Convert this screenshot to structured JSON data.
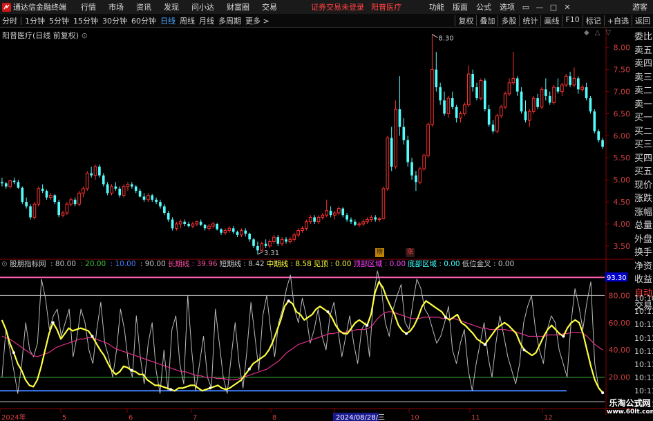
{
  "titlebar": {
    "app_name": "通达信金融终端",
    "menus": [
      "行情",
      "市场",
      "资讯",
      "发现",
      "问小达",
      "财富圈",
      "交易"
    ],
    "notice": "证券交易未登录",
    "stock": "阳普医疗",
    "right_menus": [
      "功能",
      "版面",
      "公式",
      "选项"
    ],
    "guest": "游客",
    "win_buttons": [
      "▭",
      "—",
      "□",
      "✕"
    ]
  },
  "toolbar": {
    "periods": [
      "分时",
      "1分钟",
      "5分钟",
      "15分钟",
      "30分钟",
      "60分钟",
      "日线",
      "周线",
      "月线",
      "多周期",
      "更多 >"
    ],
    "active_period": "日线",
    "right_buttons": [
      "复权",
      "叠加",
      "多股",
      "统计",
      "画线",
      "F10",
      "标记",
      "+自选",
      "返回"
    ]
  },
  "stock_header": "阳普医疗(日线 前复权)",
  "price_axis": [
    "8.00",
    "7.50",
    "7.00",
    "6.50",
    "6.00",
    "5.50",
    "5.00",
    "4.50",
    "4.00",
    "3.50"
  ],
  "markers": {
    "high": "8.30",
    "low": "3.31"
  },
  "badges": {
    "b1": "榜",
    "b2": "涨"
  },
  "indicator": {
    "name": "股朋指标网",
    "params": [
      {
        "label": "",
        "value": "80.00",
        "color": "#c8c8c8"
      },
      {
        "label": "",
        "value": "20.00",
        "color": "#40c040"
      },
      {
        "label": "",
        "value": "10.00",
        "color": "#4080ff"
      },
      {
        "label": "",
        "value": "90.00",
        "color": "#c8c8c8"
      },
      {
        "label": "长期线",
        "value": "39.96",
        "color": "#ff4fa0"
      },
      {
        "label": "短期线",
        "value": "8.42",
        "color": "#c8c8c8"
      },
      {
        "label": "中期线",
        "value": "8.58",
        "color": "#ffff40"
      },
      {
        "label": "见顶",
        "value": "0.00",
        "color": "#ffff40"
      },
      {
        "label": "顶部区域",
        "value": "0.00",
        "color": "#ff40ff"
      },
      {
        "label": "底部区域",
        "value": "0.00",
        "color": "#40ffff"
      },
      {
        "label": "低位金叉",
        "value": "0.00",
        "color": "#c8c8c8"
      }
    ],
    "axis": [
      "93.30",
      "80.00",
      "60.00",
      "40.00",
      "20.00"
    ]
  },
  "date_axis": [
    "2024年",
    "5",
    "6",
    "7",
    "8",
    "2024/08/28/三",
    "10",
    "11",
    "12"
  ],
  "side_panel": [
    "委比",
    "卖五",
    "卖四",
    "卖三",
    "卖二",
    "卖一",
    "买一",
    "买二",
    "买三",
    "买四",
    "买五",
    "现价",
    "涨跌",
    "涨幅",
    "总量",
    "外盘",
    "换手",
    "净资",
    "收益",
    "自动",
    "交易"
  ],
  "time_col": [
    "10:10",
    "10:11",
    "10:11",
    "10:11",
    "10:11",
    "10:11",
    "10:11",
    "10:11",
    "10:11"
  ],
  "watermark": {
    "line1": "乐淘公式网",
    "line2": "www.60lt.com"
  },
  "colors": {
    "up": "#ff3232",
    "down": "#54fcfc",
    "pink": "#ff5fb0",
    "yellow": "#ffff40",
    "green": "#40c040",
    "blue": "#4080ff",
    "grid": "#8b0000"
  },
  "chart_data": {
    "type": "candlestick",
    "price_range": [
      3.2,
      8.45
    ],
    "indicator_range": [
      0,
      100
    ],
    "candles": [
      [
        4.95,
        5.05,
        4.85,
        4.92
      ],
      [
        4.92,
        4.95,
        4.8,
        4.85
      ],
      [
        4.85,
        5.0,
        4.8,
        4.98
      ],
      [
        4.98,
        5.05,
        4.9,
        4.95
      ],
      [
        4.95,
        5.0,
        4.8,
        4.82
      ],
      [
        4.82,
        4.85,
        4.45,
        4.5
      ],
      [
        4.5,
        4.6,
        4.35,
        4.4
      ],
      [
        4.4,
        4.45,
        4.1,
        4.15
      ],
      [
        4.15,
        4.5,
        4.1,
        4.45
      ],
      [
        4.45,
        4.85,
        4.4,
        4.8
      ],
      [
        4.8,
        4.9,
        4.7,
        4.75
      ],
      [
        4.75,
        4.78,
        4.55,
        4.6
      ],
      [
        4.6,
        4.7,
        4.55,
        4.65
      ],
      [
        4.65,
        4.68,
        4.45,
        4.5
      ],
      [
        4.5,
        4.55,
        4.15,
        4.2
      ],
      [
        4.2,
        4.3,
        4.15,
        4.25
      ],
      [
        4.25,
        4.5,
        4.2,
        4.45
      ],
      [
        4.45,
        4.6,
        4.4,
        4.55
      ],
      [
        4.55,
        4.6,
        4.4,
        4.45
      ],
      [
        4.45,
        4.75,
        4.4,
        4.7
      ],
      [
        4.7,
        4.85,
        4.6,
        4.8
      ],
      [
        4.8,
        5.2,
        4.75,
        5.15
      ],
      [
        5.15,
        5.3,
        5.05,
        5.1
      ],
      [
        5.1,
        5.35,
        5.0,
        5.3
      ],
      [
        5.3,
        5.35,
        5.05,
        5.1
      ],
      [
        5.1,
        5.15,
        4.85,
        4.9
      ],
      [
        4.9,
        4.95,
        4.65,
        4.7
      ],
      [
        4.7,
        4.9,
        4.65,
        4.85
      ],
      [
        4.85,
        4.95,
        4.75,
        4.8
      ],
      [
        4.8,
        4.85,
        4.6,
        4.65
      ],
      [
        4.65,
        4.9,
        4.6,
        4.85
      ],
      [
        4.85,
        4.95,
        4.75,
        4.9
      ],
      [
        4.9,
        4.95,
        4.8,
        4.85
      ],
      [
        4.85,
        4.88,
        4.7,
        4.75
      ],
      [
        4.75,
        4.8,
        4.6,
        4.62
      ],
      [
        4.62,
        4.7,
        4.5,
        4.55
      ],
      [
        4.55,
        4.7,
        4.5,
        4.65
      ],
      [
        4.65,
        4.68,
        4.5,
        4.55
      ],
      [
        4.55,
        4.6,
        4.45,
        4.5
      ],
      [
        4.5,
        4.55,
        4.35,
        4.4
      ],
      [
        4.4,
        4.45,
        4.2,
        4.25
      ],
      [
        4.25,
        4.3,
        4.05,
        4.1
      ],
      [
        4.1,
        4.15,
        3.85,
        3.9
      ],
      [
        3.9,
        4.05,
        3.85,
        4.0
      ],
      [
        4.0,
        4.1,
        3.9,
        4.05
      ],
      [
        4.05,
        4.1,
        3.95,
        4.0
      ],
      [
        4.0,
        4.05,
        3.92,
        3.95
      ],
      [
        3.95,
        4.05,
        3.9,
        4.0
      ],
      [
        4.0,
        4.08,
        3.95,
        4.05
      ],
      [
        4.05,
        4.1,
        3.95,
        3.98
      ],
      [
        3.98,
        4.0,
        3.85,
        3.9
      ],
      [
        3.9,
        4.0,
        3.85,
        3.95
      ],
      [
        3.95,
        4.05,
        3.9,
        4.0
      ],
      [
        4.0,
        4.02,
        3.85,
        3.88
      ],
      [
        3.88,
        3.9,
        3.75,
        3.8
      ],
      [
        3.8,
        3.9,
        3.75,
        3.85
      ],
      [
        3.85,
        3.95,
        3.8,
        3.9
      ],
      [
        3.9,
        3.95,
        3.78,
        3.82
      ],
      [
        3.82,
        3.85,
        3.7,
        3.75
      ],
      [
        3.75,
        3.9,
        3.7,
        3.85
      ],
      [
        3.85,
        3.9,
        3.72,
        3.78
      ],
      [
        3.78,
        3.8,
        3.6,
        3.65
      ],
      [
        3.65,
        3.68,
        3.45,
        3.5
      ],
      [
        3.5,
        3.6,
        3.31,
        3.4
      ],
      [
        3.4,
        3.6,
        3.38,
        3.55
      ],
      [
        3.55,
        3.65,
        3.45,
        3.5
      ],
      [
        3.5,
        3.65,
        3.45,
        3.6
      ],
      [
        3.6,
        3.75,
        3.55,
        3.7
      ],
      [
        3.7,
        3.75,
        3.5,
        3.55
      ],
      [
        3.55,
        3.7,
        3.5,
        3.65
      ],
      [
        3.65,
        3.7,
        3.55,
        3.6
      ],
      [
        3.6,
        3.7,
        3.55,
        3.65
      ],
      [
        3.65,
        3.8,
        3.6,
        3.75
      ],
      [
        3.75,
        3.9,
        3.7,
        3.85
      ],
      [
        3.85,
        3.95,
        3.8,
        3.9
      ],
      [
        3.9,
        4.1,
        3.85,
        4.05
      ],
      [
        4.05,
        4.2,
        4.0,
        4.15
      ],
      [
        4.15,
        4.2,
        4.0,
        4.05
      ],
      [
        4.05,
        4.2,
        4.0,
        4.15
      ],
      [
        4.15,
        4.25,
        4.1,
        4.2
      ],
      [
        4.2,
        4.55,
        4.15,
        4.3
      ],
      [
        4.3,
        4.4,
        4.15,
        4.2
      ],
      [
        4.2,
        4.3,
        4.1,
        4.25
      ],
      [
        4.25,
        4.4,
        4.2,
        4.35
      ],
      [
        4.35,
        4.38,
        4.15,
        4.2
      ],
      [
        4.2,
        4.25,
        4.05,
        4.1
      ],
      [
        4.1,
        4.15,
        4.0,
        4.05
      ],
      [
        4.05,
        4.1,
        3.95,
        3.98
      ],
      [
        3.98,
        4.05,
        3.92,
        4.0
      ],
      [
        4.0,
        4.1,
        3.95,
        4.05
      ],
      [
        4.05,
        4.15,
        4.0,
        4.1
      ],
      [
        4.1,
        4.2,
        4.05,
        4.15
      ],
      [
        4.15,
        4.2,
        4.05,
        4.1
      ],
      [
        4.1,
        4.15,
        4.05,
        4.12
      ],
      [
        4.12,
        4.85,
        4.1,
        4.8
      ],
      [
        4.8,
        6.0,
        4.75,
        5.95
      ],
      [
        5.95,
        6.2,
        5.2,
        5.3
      ],
      [
        5.3,
        6.8,
        5.25,
        6.6
      ],
      [
        6.6,
        7.35,
        6.0,
        6.2
      ],
      [
        6.2,
        6.4,
        5.8,
        5.9
      ],
      [
        5.9,
        6.0,
        5.3,
        5.4
      ],
      [
        5.4,
        5.5,
        5.0,
        5.1
      ],
      [
        5.1,
        5.2,
        4.75,
        4.95
      ],
      [
        4.95,
        5.3,
        4.9,
        5.25
      ],
      [
        5.25,
        5.6,
        5.2,
        5.55
      ],
      [
        5.55,
        6.3,
        5.5,
        6.25
      ],
      [
        6.25,
        8.3,
        6.2,
        7.5
      ],
      [
        7.5,
        7.9,
        7.0,
        7.1
      ],
      [
        7.1,
        7.2,
        6.7,
        6.8
      ],
      [
        6.8,
        7.0,
        6.45,
        6.5
      ],
      [
        6.5,
        6.9,
        6.4,
        6.85
      ],
      [
        6.85,
        7.0,
        6.6,
        6.65
      ],
      [
        6.65,
        6.7,
        6.3,
        6.4
      ],
      [
        6.4,
        6.55,
        6.3,
        6.5
      ],
      [
        6.5,
        6.75,
        6.45,
        6.7
      ],
      [
        6.7,
        7.6,
        6.65,
        7.4
      ],
      [
        7.4,
        7.5,
        7.0,
        7.1
      ],
      [
        7.1,
        7.2,
        6.8,
        6.85
      ],
      [
        6.85,
        7.3,
        6.8,
        7.25
      ],
      [
        7.25,
        7.3,
        6.55,
        6.6
      ],
      [
        6.6,
        6.7,
        6.2,
        6.25
      ],
      [
        6.25,
        6.35,
        6.05,
        6.1
      ],
      [
        6.1,
        6.5,
        6.05,
        6.45
      ],
      [
        6.45,
        6.7,
        6.4,
        6.65
      ],
      [
        6.65,
        7.0,
        6.6,
        6.95
      ],
      [
        6.95,
        7.3,
        6.9,
        7.2
      ],
      [
        7.2,
        7.9,
        7.15,
        7.3
      ],
      [
        7.3,
        7.35,
        6.9,
        7.0
      ],
      [
        7.0,
        7.1,
        6.5,
        6.55
      ],
      [
        6.55,
        6.8,
        6.3,
        6.35
      ],
      [
        6.35,
        6.6,
        6.2,
        6.55
      ],
      [
        6.55,
        6.9,
        6.5,
        6.85
      ],
      [
        6.85,
        6.95,
        6.6,
        6.65
      ],
      [
        6.65,
        7.1,
        6.6,
        7.05
      ],
      [
        7.05,
        7.3,
        6.8,
        6.9
      ],
      [
        6.9,
        7.0,
        6.7,
        6.75
      ],
      [
        6.75,
        7.15,
        6.7,
        7.1
      ],
      [
        7.1,
        7.3,
        6.95,
        7.0
      ],
      [
        7.0,
        7.2,
        6.9,
        7.15
      ],
      [
        7.15,
        7.4,
        7.1,
        7.35
      ],
      [
        7.35,
        7.45,
        7.1,
        7.15
      ],
      [
        7.15,
        7.55,
        7.1,
        7.3
      ],
      [
        7.3,
        7.35,
        6.95,
        7.05
      ],
      [
        7.05,
        7.15,
        7.0,
        7.1
      ],
      [
        7.1,
        7.2,
        6.8,
        6.85
      ],
      [
        6.85,
        6.9,
        6.5,
        6.55
      ],
      [
        6.55,
        6.6,
        6.05,
        6.1
      ],
      [
        6.1,
        6.15,
        5.85,
        5.9
      ],
      [
        5.9,
        5.95,
        5.7,
        5.75
      ]
    ],
    "series_mid": [
      62,
      55,
      45,
      38,
      30,
      25,
      18,
      14,
      13,
      18,
      28,
      40,
      52,
      60,
      55,
      48,
      52,
      56,
      54,
      55,
      56,
      55,
      54,
      50,
      45,
      40,
      36,
      30,
      25,
      22,
      24,
      28,
      27,
      25,
      24,
      22,
      22,
      18,
      16,
      14,
      14,
      13,
      12,
      11,
      10,
      12,
      12,
      13,
      14,
      14,
      12,
      10,
      11,
      12,
      13,
      14,
      12,
      11,
      12,
      14,
      16,
      18,
      22,
      26,
      30,
      32,
      34,
      36,
      40,
      46,
      54,
      62,
      72,
      76,
      74,
      68,
      66,
      62,
      64,
      66,
      70,
      72,
      70,
      68,
      64,
      58,
      54,
      52,
      52,
      56,
      60,
      62,
      60,
      58,
      66,
      82,
      90,
      86,
      78,
      72,
      66,
      58,
      54,
      52,
      54,
      58,
      64,
      72,
      76,
      74,
      72,
      70,
      68,
      64,
      62,
      64,
      66,
      60,
      58,
      55,
      52,
      48,
      46,
      44,
      48,
      52,
      56,
      58,
      60,
      58,
      55,
      52,
      45,
      40,
      38,
      36,
      38,
      44,
      50,
      55,
      58,
      55,
      52,
      50,
      56,
      60,
      62,
      60,
      52,
      40,
      28,
      18,
      12,
      8.58
    ],
    "series_long": [
      50,
      49,
      48,
      46,
      44,
      42,
      40,
      38,
      36,
      35,
      36,
      37,
      38,
      40,
      42,
      43,
      44,
      45,
      46,
      47,
      48,
      48,
      49,
      49,
      48,
      47,
      46,
      45,
      43,
      41,
      40,
      39,
      38,
      37,
      36,
      35,
      34,
      33,
      32,
      31,
      30,
      29,
      28,
      27,
      26,
      25,
      24,
      24,
      23,
      22,
      21,
      21,
      20,
      20,
      20,
      19,
      19,
      19,
      18,
      18,
      18,
      19,
      20,
      21,
      22,
      23,
      24,
      25,
      26,
      28,
      30,
      32,
      35,
      38,
      40,
      42,
      44,
      45,
      46,
      47,
      48,
      49,
      50,
      51,
      52,
      52,
      53,
      53,
      53,
      54,
      54,
      55,
      55,
      55,
      56,
      58,
      62,
      65,
      67,
      68,
      68,
      67,
      66,
      65,
      64,
      63,
      63,
      63,
      64,
      64,
      64,
      64,
      64,
      63,
      63,
      63,
      63,
      62,
      61,
      60,
      59,
      58,
      57,
      56,
      56,
      55,
      55,
      55,
      55,
      55,
      54,
      54,
      53,
      52,
      51,
      50,
      50,
      50,
      50,
      50,
      51,
      51,
      51,
      51,
      52,
      52,
      53,
      53,
      53,
      52,
      50,
      47,
      44,
      42,
      39.96
    ],
    "series_short": [
      20,
      55,
      40,
      25,
      8,
      30,
      60,
      40,
      35,
      45,
      92,
      78,
      55,
      65,
      70,
      50,
      60,
      70,
      35,
      50,
      70,
      60,
      40,
      30,
      55,
      75,
      45,
      35,
      20,
      40,
      70,
      55,
      30,
      20,
      65,
      35,
      15,
      45,
      60,
      25,
      8,
      40,
      10,
      55,
      65,
      30,
      15,
      80,
      40,
      10,
      30,
      50,
      20,
      12,
      70,
      45,
      20,
      8,
      35,
      60,
      30,
      12,
      40,
      75,
      50,
      25,
      65,
      80,
      55,
      35,
      60,
      70,
      85,
      95,
      70,
      60,
      78,
      65,
      45,
      55,
      70,
      50,
      40,
      65,
      75,
      55,
      35,
      50,
      65,
      45,
      30,
      55,
      60,
      35,
      78,
      98,
      85,
      60,
      50,
      70,
      80,
      88,
      60,
      55,
      75,
      92,
      85,
      70,
      65,
      55,
      45,
      50,
      60,
      72,
      40,
      30,
      45,
      55,
      25,
      10,
      30,
      45,
      60,
      35,
      20,
      45,
      65,
      50,
      35,
      25,
      15,
      30,
      60,
      72,
      80,
      55,
      40,
      30,
      55,
      65,
      60,
      40,
      30,
      20,
      60,
      85,
      72,
      55,
      75,
      90,
      30,
      12,
      8.42
    ],
    "mid_close": 8.58,
    "long_close": 39.96,
    "short_close": 8.42
  }
}
